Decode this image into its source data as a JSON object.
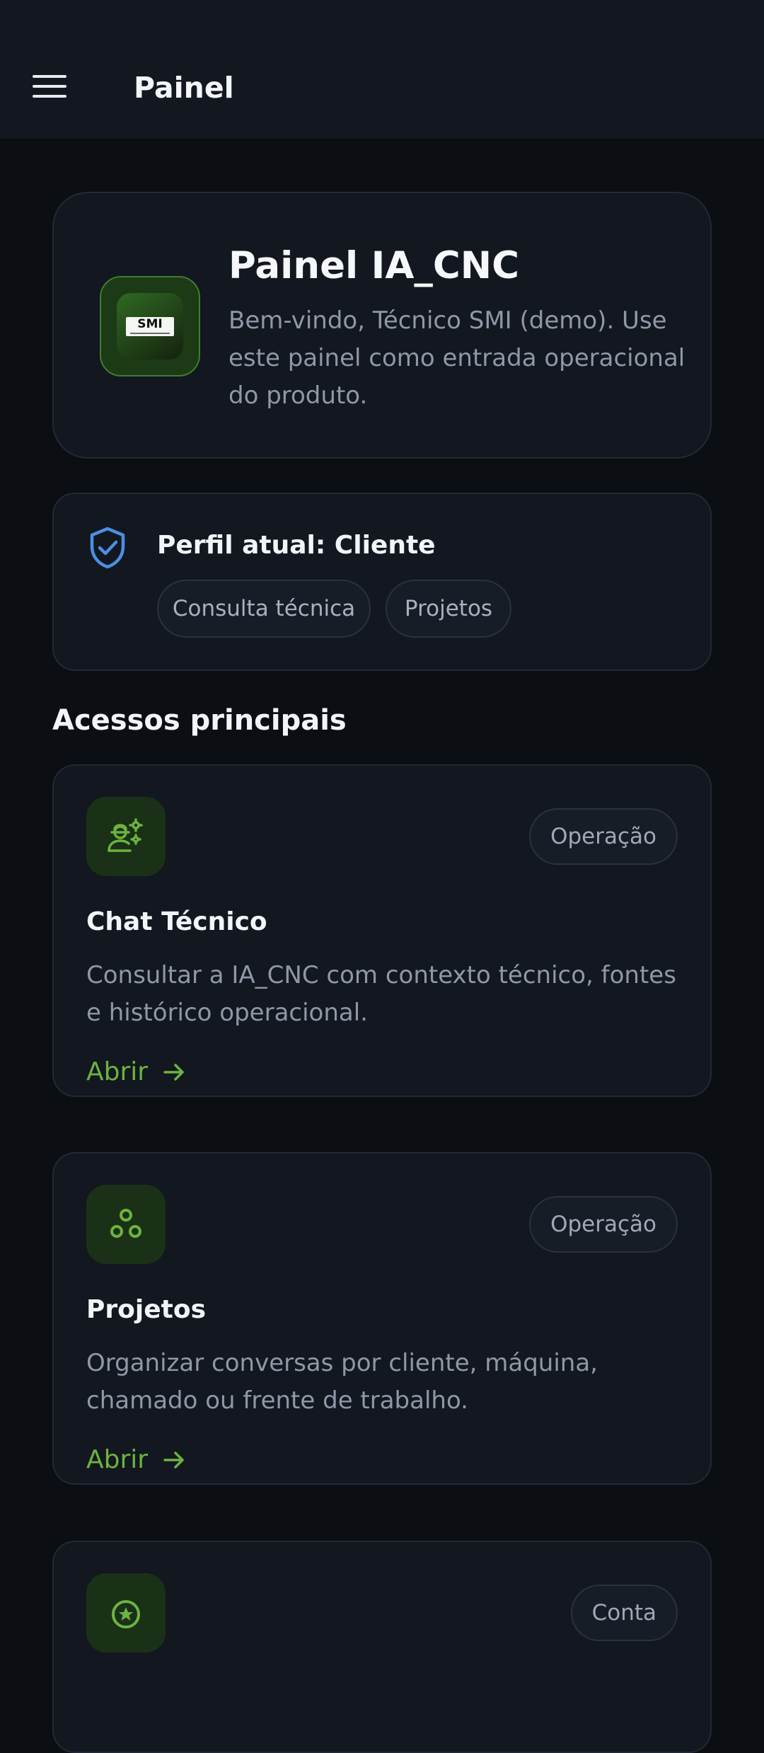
{
  "topbar": {
    "title": "Painel"
  },
  "hero": {
    "logo_text": "SMI",
    "title": "Painel IA_CNC",
    "description": "Bem-vindo, Técnico SMI (demo). Use este painel como entrada operacional do produto."
  },
  "profile": {
    "title": "Perfil atual: Cliente",
    "chips": [
      "Consulta técnica",
      "Projetos"
    ]
  },
  "section": {
    "title": "Acessos principais"
  },
  "cards": [
    {
      "icon": "technician-gears-icon",
      "tag": "Operação",
      "title": "Chat Técnico",
      "description": "Consultar a IA_CNC com contexto técnico, fontes e histórico operacional.",
      "link": "Abrir"
    },
    {
      "icon": "projects-circles-icon",
      "tag": "Operação",
      "title": "Projetos",
      "description": "Organizar conversas por cliente, máquina, chamado ou frente de trabalho.",
      "link": "Abrir"
    },
    {
      "icon": "star-circle-icon",
      "tag": "Conta"
    }
  ],
  "colors": {
    "background": "#0b0e12",
    "card": "#121720",
    "accent_green": "#6db33f",
    "shield_blue": "#4a90e2"
  }
}
